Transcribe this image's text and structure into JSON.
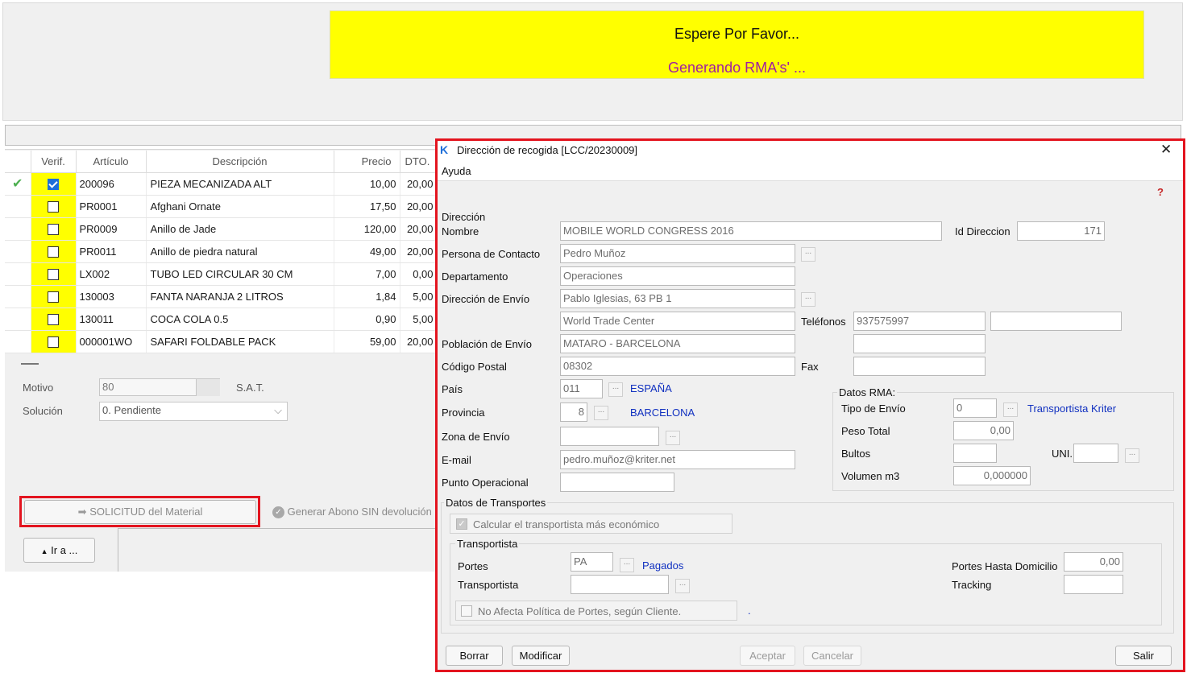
{
  "banner": {
    "title": "Espere Por Favor...",
    "subtitle": "Generando RMA's' ..."
  },
  "grid": {
    "columns": [
      "Verif.",
      "Artículo",
      "Descripción",
      "Precio",
      "DTO."
    ],
    "rows": [
      {
        "marked": true,
        "checked": true,
        "articulo": "200096",
        "descripcion": "PIEZA MECANIZADA ALT",
        "precio": "10,00",
        "dto": "20,00"
      },
      {
        "marked": false,
        "checked": false,
        "articulo": "PR0001",
        "descripcion": "Afghani Ornate",
        "precio": "17,50",
        "dto": "20,00"
      },
      {
        "marked": false,
        "checked": false,
        "articulo": "PR0009",
        "descripcion": "Anillo de Jade",
        "precio": "120,00",
        "dto": "20,00"
      },
      {
        "marked": false,
        "checked": false,
        "articulo": "PR0011",
        "descripcion": "Anillo de piedra natural",
        "precio": "49,00",
        "dto": "20,00"
      },
      {
        "marked": false,
        "checked": false,
        "articulo": "LX002",
        "descripcion": "TUBO LED CIRCULAR 30 CM",
        "precio": "7,00",
        "dto": "0,00"
      },
      {
        "marked": false,
        "checked": false,
        "articulo": "130003",
        "descripcion": "FANTA NARANJA 2 LITROS",
        "precio": "1,84",
        "dto": "5,00"
      },
      {
        "marked": false,
        "checked": false,
        "articulo": "130011",
        "descripcion": "COCA COLA 0.5",
        "precio": "0,90",
        "dto": "5,00"
      },
      {
        "marked": false,
        "checked": false,
        "articulo": "000001WO",
        "descripcion": "SAFARI FOLDABLE PACK",
        "precio": "59,00",
        "dto": "20,00"
      }
    ]
  },
  "form": {
    "motivo_label": "Motivo",
    "motivo_value": "80",
    "sat_label": "S.A.T.",
    "solucion_label": "Solución",
    "solucion_value": "0. Pendiente",
    "solicitud_button": "SOLICITUD del Material",
    "generar_button": "Generar Abono SIN devolución",
    "ira_button": "Ir a ..."
  },
  "dialog": {
    "title": "Dirección de recogida  [LCC/20230009]",
    "menu_ayuda": "Ayuda",
    "direccion_group": "Dirección",
    "nombre_label": "Nombre",
    "nombre_value": "MOBILE WORLD CONGRESS 2016",
    "id_direccion_label": "Id Direccion",
    "id_direccion_value": "171",
    "contacto_label": "Persona de Contacto",
    "contacto_value": "Pedro Muñoz",
    "departamento_label": "Departamento",
    "departamento_value": "Operaciones",
    "direccion_envio_label": "Dirección de Envío",
    "direccion_envio_value1": "Pablo Iglesias, 63 PB 1",
    "direccion_envio_value2": "World Trade Center",
    "telefonos_label": "Teléfonos",
    "telefono1_value": "937575997",
    "telefono2_value": "",
    "poblacion_label": "Población de Envío",
    "poblacion_value": "MATARO - BARCELONA",
    "codigo_postal_label": "Código Postal",
    "codigo_postal_value": "08302",
    "fax_label": "Fax",
    "fax_value": "",
    "pais_label": "País",
    "pais_value": "011",
    "pais_name": "ESPAÑA",
    "provincia_label": "Provincia",
    "provincia_value": "8",
    "provincia_name": "BARCELONA",
    "zona_label": "Zona de Envío",
    "zona_value": "",
    "email_label": "E-mail",
    "email_value": "pedro.muñoz@kriter.net",
    "punto_label": "Punto Operacional",
    "punto_value": "",
    "rma_group": "Datos RMA:",
    "tipo_envio_label": "Tipo de Envío",
    "tipo_envio_value": "0",
    "tipo_envio_name": "Transportista Kriter",
    "peso_label": "Peso Total",
    "peso_value": "0,00",
    "bultos_label": "Bultos",
    "bultos_value": "",
    "uni_label": "UNI.",
    "uni_value": "",
    "volumen_label": "Volumen m3",
    "volumen_value": "0,000000",
    "transportes_group": "Datos de Transportes",
    "calcular_label": "Calcular el transportista más económico",
    "transportista_group": "Transportista",
    "portes_label": "Portes",
    "portes_value": "PA",
    "portes_name": "Pagados",
    "transportista_label": "Transportista",
    "transportista_value": "",
    "portes_hasta_label": "Portes Hasta Domicilio",
    "portes_hasta_value": "0,00",
    "tracking_label": "Tracking",
    "tracking_value": "",
    "no_afecta_label": "No Afecta Política de Portes, según Cliente.",
    "stray_dot": ".",
    "borrar_button": "Borrar",
    "modificar_button": "Modificar",
    "aceptar_button": "Aceptar",
    "cancelar_button": "Cancelar",
    "salir_button": "Salir"
  }
}
